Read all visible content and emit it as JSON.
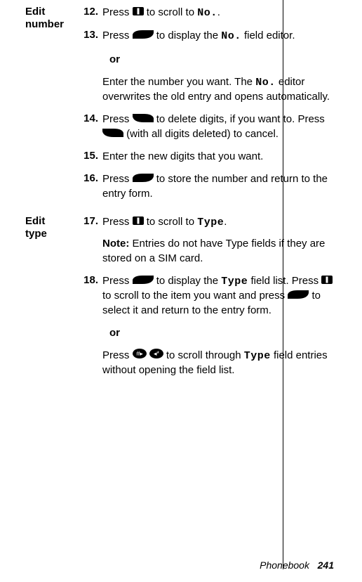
{
  "sections": {
    "edit_number": {
      "heading_line1": "Edit",
      "heading_line2": "number",
      "steps": {
        "s12": {
          "num": "12.",
          "pre": "Press ",
          "post": " to scroll to ",
          "field": "No.",
          "tail": "."
        },
        "s13": {
          "num": "13.",
          "pre": "Press ",
          "mid": " to display the ",
          "field": "No.",
          "post": " field editor.",
          "or": "or",
          "alt_pre": "Enter the number you want. The ",
          "alt_field": "No.",
          "alt_post": " editor overwrites the old entry and opens automatically."
        },
        "s14": {
          "num": "14.",
          "pre": "Press ",
          "mid": " to delete digits, if you want to. Press ",
          "post": " (with all digits deleted) to cancel."
        },
        "s15": {
          "num": "15.",
          "text": "Enter the new digits that you want."
        },
        "s16": {
          "num": "16.",
          "pre": "Press ",
          "post": " to store the number and return to the entry form."
        }
      }
    },
    "edit_type": {
      "heading_line1": "Edit",
      "heading_line2": "type",
      "steps": {
        "s17": {
          "num": "17.",
          "pre": "Press ",
          "mid": " to scroll to ",
          "field": "Type",
          "post": ".",
          "note_label": "Note:",
          "note_text": " Entries do not have Type fields if they are stored on a SIM card."
        },
        "s18": {
          "num": "18.",
          "pre": "Press ",
          "mid1": " to display the ",
          "field1": "Type",
          "mid2": " field list. Press ",
          "mid3": " to scroll to the item you want and press ",
          "post": " to select it and return to the entry form.",
          "or": "or",
          "alt_pre": "Press ",
          "alt_mid": " to scroll through ",
          "alt_field": "Type",
          "alt_post": " field entries without opening the field list."
        }
      }
    }
  },
  "footer": {
    "section": "Phonebook",
    "page": "241"
  }
}
